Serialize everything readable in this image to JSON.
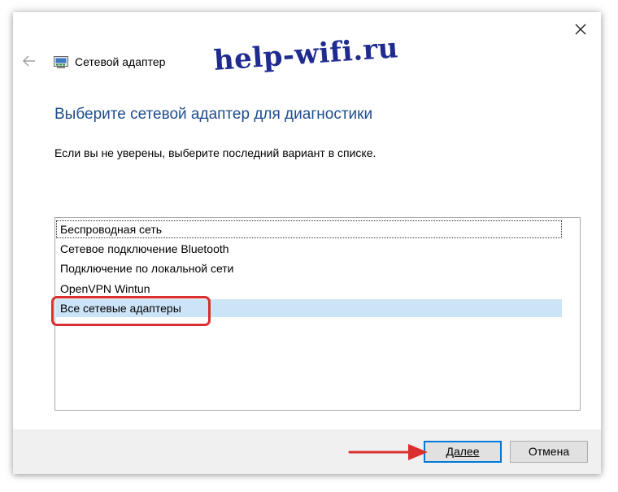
{
  "window": {
    "title": "Сетевой адаптер",
    "back_icon": "arrow-left-icon",
    "close_icon": "close-icon",
    "adapter_icon": "network-adapter-icon"
  },
  "watermark": {
    "text": "help-wifi.ru",
    "color": "#1f2b8f"
  },
  "content": {
    "heading": "Выберите сетевой адаптер для диагностики",
    "heading_color": "#1e4e8c",
    "instruction": "Если вы не уверены, выберите последний вариант в списке."
  },
  "adapter_list": {
    "items": [
      {
        "label": "Беспроводная сеть",
        "focused": true,
        "selected": false
      },
      {
        "label": "Сетевое подключение Bluetooth",
        "focused": false,
        "selected": false
      },
      {
        "label": "Подключение по локальной сети",
        "focused": false,
        "selected": false
      },
      {
        "label": "OpenVPN Wintun",
        "focused": false,
        "selected": false
      },
      {
        "label": "Все сетевые адаптеры",
        "focused": false,
        "selected": true
      }
    ],
    "selection_color": "#cce4f7"
  },
  "annotations": {
    "highlight_color": "#d9302f",
    "arrow_color": "#d9302f"
  },
  "footer": {
    "next_label": "Далее",
    "cancel_label": "Отмена",
    "accent_color": "#0078d7"
  }
}
